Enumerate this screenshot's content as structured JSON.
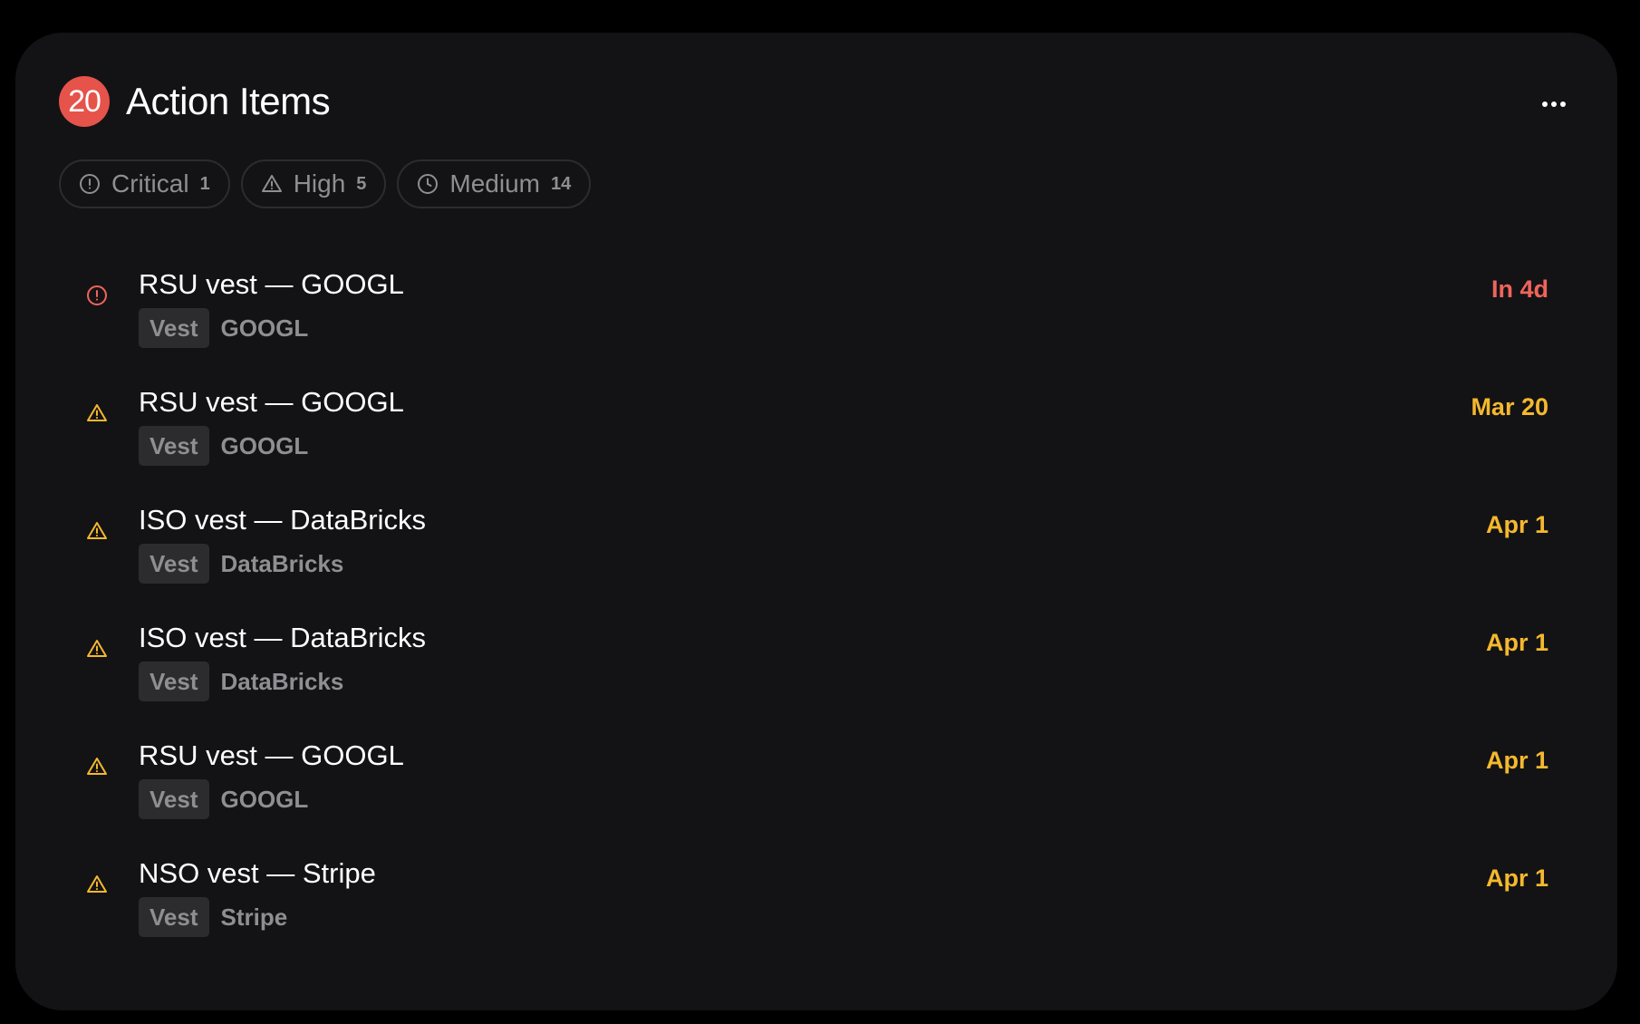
{
  "header": {
    "count": "20",
    "title": "Action Items",
    "more_icon": "more-horizontal-icon"
  },
  "filters": [
    {
      "label": "Critical",
      "count": "1",
      "icon": "alert-circle-icon"
    },
    {
      "label": "High",
      "count": "5",
      "icon": "alert-triangle-icon"
    },
    {
      "label": "Medium",
      "count": "14",
      "icon": "clock-icon"
    }
  ],
  "items": [
    {
      "title": "RSU vest — GOOGL",
      "tag": "Vest",
      "company": "GOOGL",
      "due": "In 4d",
      "severity": "critical",
      "icon": "alert-circle-icon",
      "color": "#f0645c"
    },
    {
      "title": "RSU vest — GOOGL",
      "tag": "Vest",
      "company": "GOOGL",
      "due": "Mar 20",
      "severity": "high",
      "icon": "alert-triangle-icon",
      "color": "#f5b82e"
    },
    {
      "title": "ISO vest — DataBricks",
      "tag": "Vest",
      "company": "DataBricks",
      "due": "Apr 1",
      "severity": "high",
      "icon": "alert-triangle-icon",
      "color": "#f5b82e"
    },
    {
      "title": "ISO vest — DataBricks",
      "tag": "Vest",
      "company": "DataBricks",
      "due": "Apr 1",
      "severity": "high",
      "icon": "alert-triangle-icon",
      "color": "#f5b82e"
    },
    {
      "title": "RSU vest — GOOGL",
      "tag": "Vest",
      "company": "GOOGL",
      "due": "Apr 1",
      "severity": "high",
      "icon": "alert-triangle-icon",
      "color": "#f5b82e"
    },
    {
      "title": "NSO vest — Stripe",
      "tag": "Vest",
      "company": "Stripe",
      "due": "Apr 1",
      "severity": "high",
      "icon": "alert-triangle-icon",
      "color": "#f5b82e"
    }
  ],
  "colors": {
    "background": "#000000",
    "card": "#131315",
    "badge": "#e5534b",
    "critical": "#f0645c",
    "high": "#f5b82e",
    "muted": "#8e8e93"
  }
}
